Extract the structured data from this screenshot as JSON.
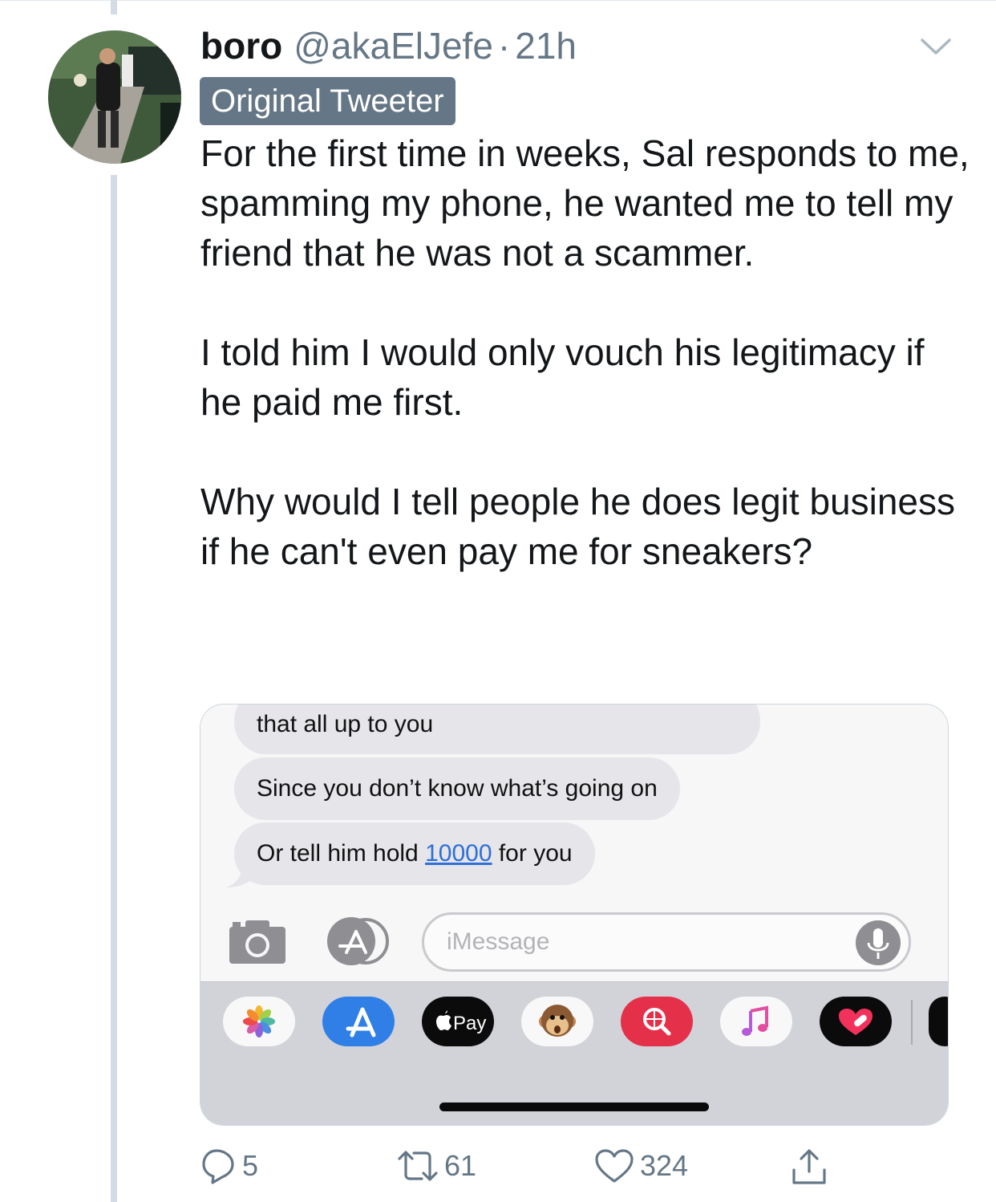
{
  "tweet": {
    "name": "boro",
    "handle": "@akaElJefe",
    "separator": "·",
    "time": "21h",
    "badge": "Original Tweeter",
    "paragraphs": [
      "For the first time in weeks, Sal responds to me, spamming my phone, he wanted me to tell my friend that he was not a scammer.",
      "I told him I would only vouch his legitimacy if he paid me first.",
      "Why would I tell people he does legit business if he can't even pay me for sneakers?"
    ]
  },
  "screenshot": {
    "messages": [
      {
        "text": "that all up to you"
      },
      {
        "text": "Since you don’t know what’s going on"
      },
      {
        "prefix": "Or tell him hold ",
        "link": "10000",
        "suffix": " for you"
      }
    ],
    "input_placeholder": "iMessage",
    "tray_apps": [
      "photos-icon",
      "app-store-icon",
      "apple-pay-icon",
      "animoji-icon",
      "web-search-icon",
      "music-icon",
      "digital-touch-icon"
    ],
    "apple_pay_label": "Pay"
  },
  "actions": {
    "replies": "5",
    "retweets": "61",
    "likes": "324"
  },
  "colors": {
    "secondary_text": "#657786",
    "badge_bg": "#657786",
    "thread_line": "#d3dce4",
    "bubble": "#e5e5ea",
    "link": "#2f6fd6"
  }
}
